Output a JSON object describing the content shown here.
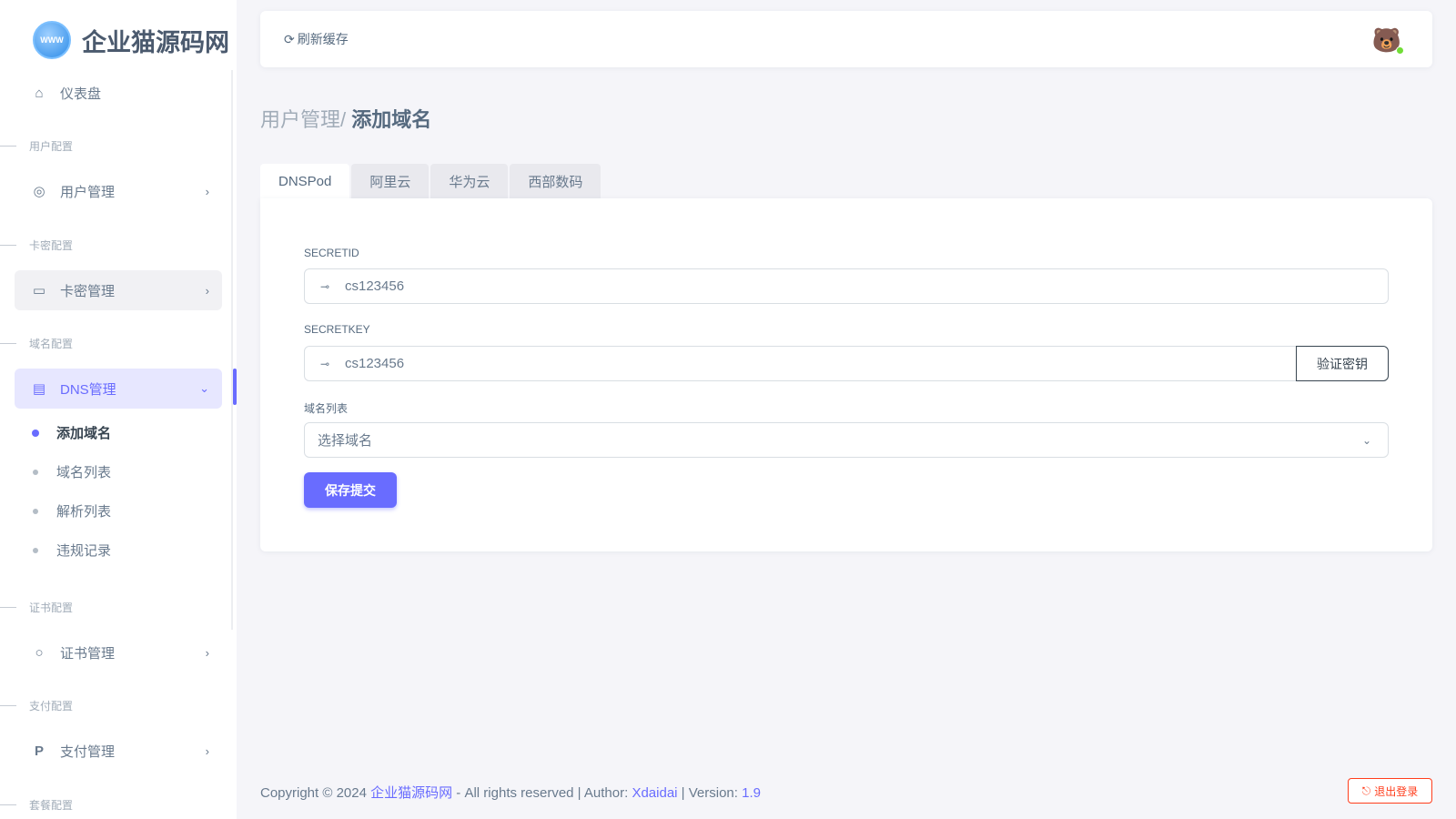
{
  "brand": {
    "name": "企业猫源码网",
    "logo_text": "WWW"
  },
  "sidebar": {
    "dashboard": "仪表盘",
    "sections": [
      "用户配置",
      "卡密配置",
      "域名配置",
      "证书配置",
      "支付配置",
      "套餐配置"
    ],
    "user_mgmt": "用户管理",
    "card_mgmt": "卡密管理",
    "dns_mgmt": "DNS管理",
    "dns_sub": [
      "添加域名",
      "域名列表",
      "解析列表",
      "违规记录"
    ],
    "cert_mgmt": "证书管理",
    "pay_mgmt": "支付管理"
  },
  "navbar": {
    "refresh": "刷新缓存"
  },
  "page": {
    "breadcrumb_parent": "用户管理/",
    "title": "添加域名"
  },
  "tabs": [
    "DNSPod",
    "阿里云",
    "华为云",
    "西部数码"
  ],
  "form": {
    "secretid_label": "SECRETID",
    "secretid_value": "cs123456",
    "secretkey_label": "SECRETKEY",
    "secretkey_value": "cs123456",
    "verify_button": "验证密钥",
    "domain_label": "域名列表",
    "domain_placeholder": "选择域名",
    "save_button": "保存提交"
  },
  "footer": {
    "copyright": "Copyright © 2024 ",
    "site": "企业猫源码网",
    "rights": " - All rights reserved | Author: ",
    "author": "Xdaidai",
    "version_label": " | Version: ",
    "version": "1.9",
    "logout": "退出登录"
  }
}
